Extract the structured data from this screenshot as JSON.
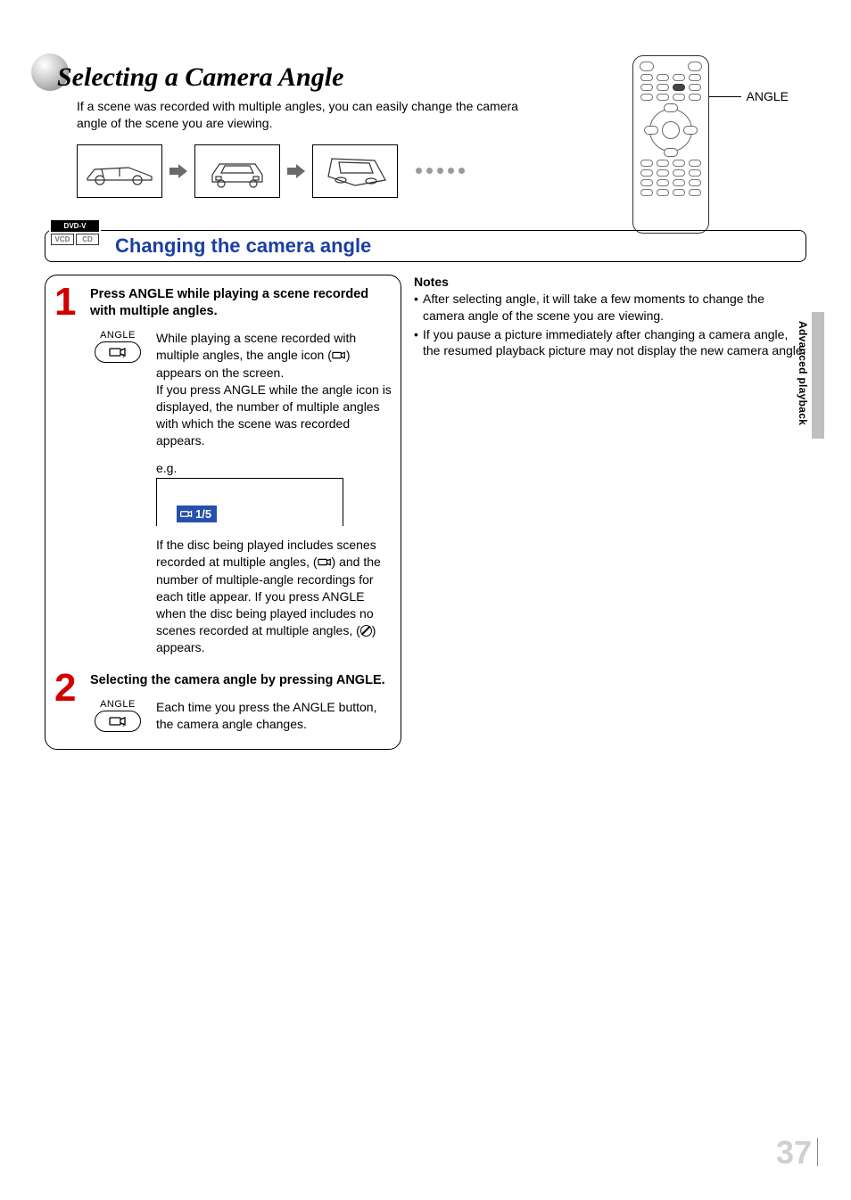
{
  "header": {
    "title": "Selecting a Camera Angle",
    "intro": "If a scene was recorded with multiple angles, you can easily change the camera angle of the scene you are viewing."
  },
  "remote": {
    "callout": "ANGLE"
  },
  "section": {
    "badges": {
      "dvdv": "DVD-V",
      "vcd": "VCD",
      "cd": "CD"
    },
    "title": "Changing the camera angle"
  },
  "steps": {
    "s1": {
      "num": "1",
      "heading": "Press ANGLE while playing a scene recorded with multiple angles.",
      "btn_label": "ANGLE",
      "para1a": "While playing a scene recorded with multiple angles, the angle icon (",
      "para1b": ") appears on the screen.",
      "para1c": "If you press ANGLE while the angle icon is displayed, the number of multiple angles with which the scene was recorded appears.",
      "eg_label": "e.g.",
      "eg_value": "1/5",
      "para2a": "If the disc being played includes scenes recorded at multiple angles, (",
      "para2b": ") and the number of multiple-angle recordings for each title appear. If you press ANGLE when the disc being played includes no scenes recorded at multiple angles, (",
      "para2c": ") appears."
    },
    "s2": {
      "num": "2",
      "heading": "Selecting the camera angle by pressing ANGLE.",
      "btn_label": "ANGLE",
      "para": "Each time you press the ANGLE button, the camera angle changes."
    }
  },
  "notes": {
    "heading": "Notes",
    "n1": "After selecting angle, it will take a few moments to change the camera angle of the scene you are viewing.",
    "n2": "If you pause a picture immediately after changing a camera angle, the resumed playback picture may not display the new camera angle."
  },
  "side_tab": "Advanced playback",
  "page_number": "37"
}
